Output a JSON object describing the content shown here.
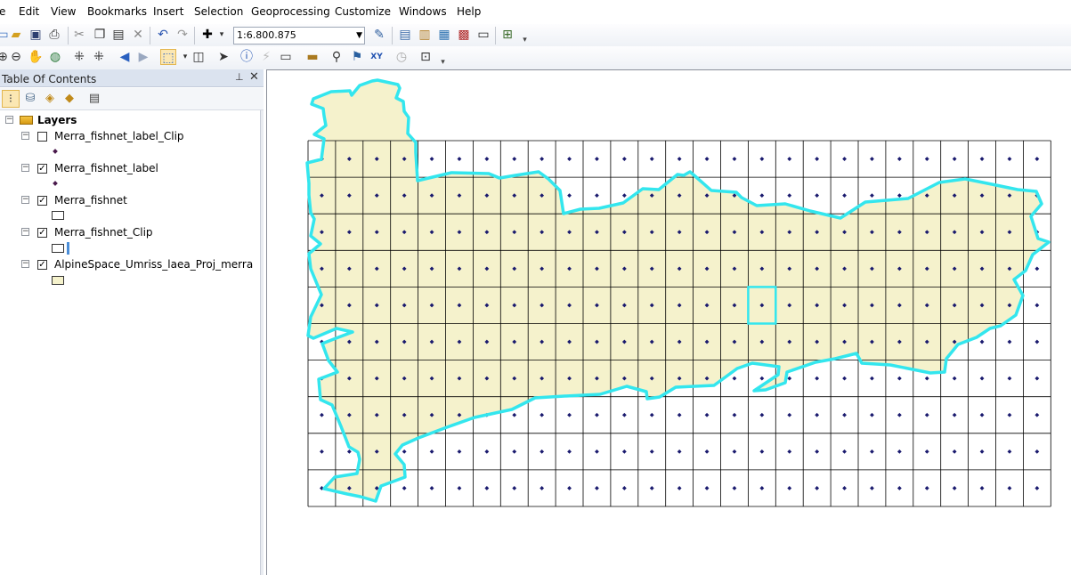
{
  "menu": [
    "e",
    "Edit",
    "View",
    "Bookmarks",
    "Insert",
    "Selection",
    "Geoprocessing",
    "Customize",
    "Windows",
    "Help"
  ],
  "toolbar": {
    "scale_value": "1:6.800.875",
    "row1_icons": [
      "new-icon",
      "open-icon",
      "save-icon",
      "print-icon",
      "cut-icon",
      "copy-icon",
      "paste-icon",
      "delete-icon",
      "undo-icon",
      "redo-icon",
      "add-data-icon"
    ],
    "row2_icons": [
      "zoom-in-icon",
      "zoom-out-icon",
      "pan-icon",
      "full-extent-icon",
      "fixed-zoom-in-icon",
      "fixed-zoom-out-icon",
      "back-icon",
      "forward-icon",
      "select-features-icon",
      "clear-selection-icon",
      "select-elements-icon",
      "identify-icon",
      "hyperlink-icon",
      "html-popup-icon",
      "measure-icon",
      "find-icon",
      "find-route-icon",
      "goto-xy-icon",
      "time-slider-icon",
      "create-viewer-icon"
    ]
  },
  "toc": {
    "title": "Table Of Contents",
    "group_label": "Layers",
    "layers": [
      {
        "name": "Merra_fishnet_label_Clip",
        "checked": false,
        "symbol": "point"
      },
      {
        "name": "Merra_fishnet_label",
        "checked": true,
        "symbol": "point"
      },
      {
        "name": "Merra_fishnet",
        "checked": true,
        "symbol": "hollow"
      },
      {
        "name": "Merra_fishnet_Clip",
        "checked": true,
        "symbol": "hollow-selected"
      },
      {
        "name": "AlpineSpace_Umriss_laea_Proj_merra",
        "checked": true,
        "symbol": "fill"
      }
    ]
  },
  "map": {
    "grid_columns": 27,
    "grid_rows": 10,
    "grid_line_color": "#000000",
    "point_color": "#1a1a6e",
    "fill_color": "#f5f2cc",
    "outline_color": "#33e6ee",
    "selected_cell": {
      "column": 16,
      "row": 4
    }
  }
}
